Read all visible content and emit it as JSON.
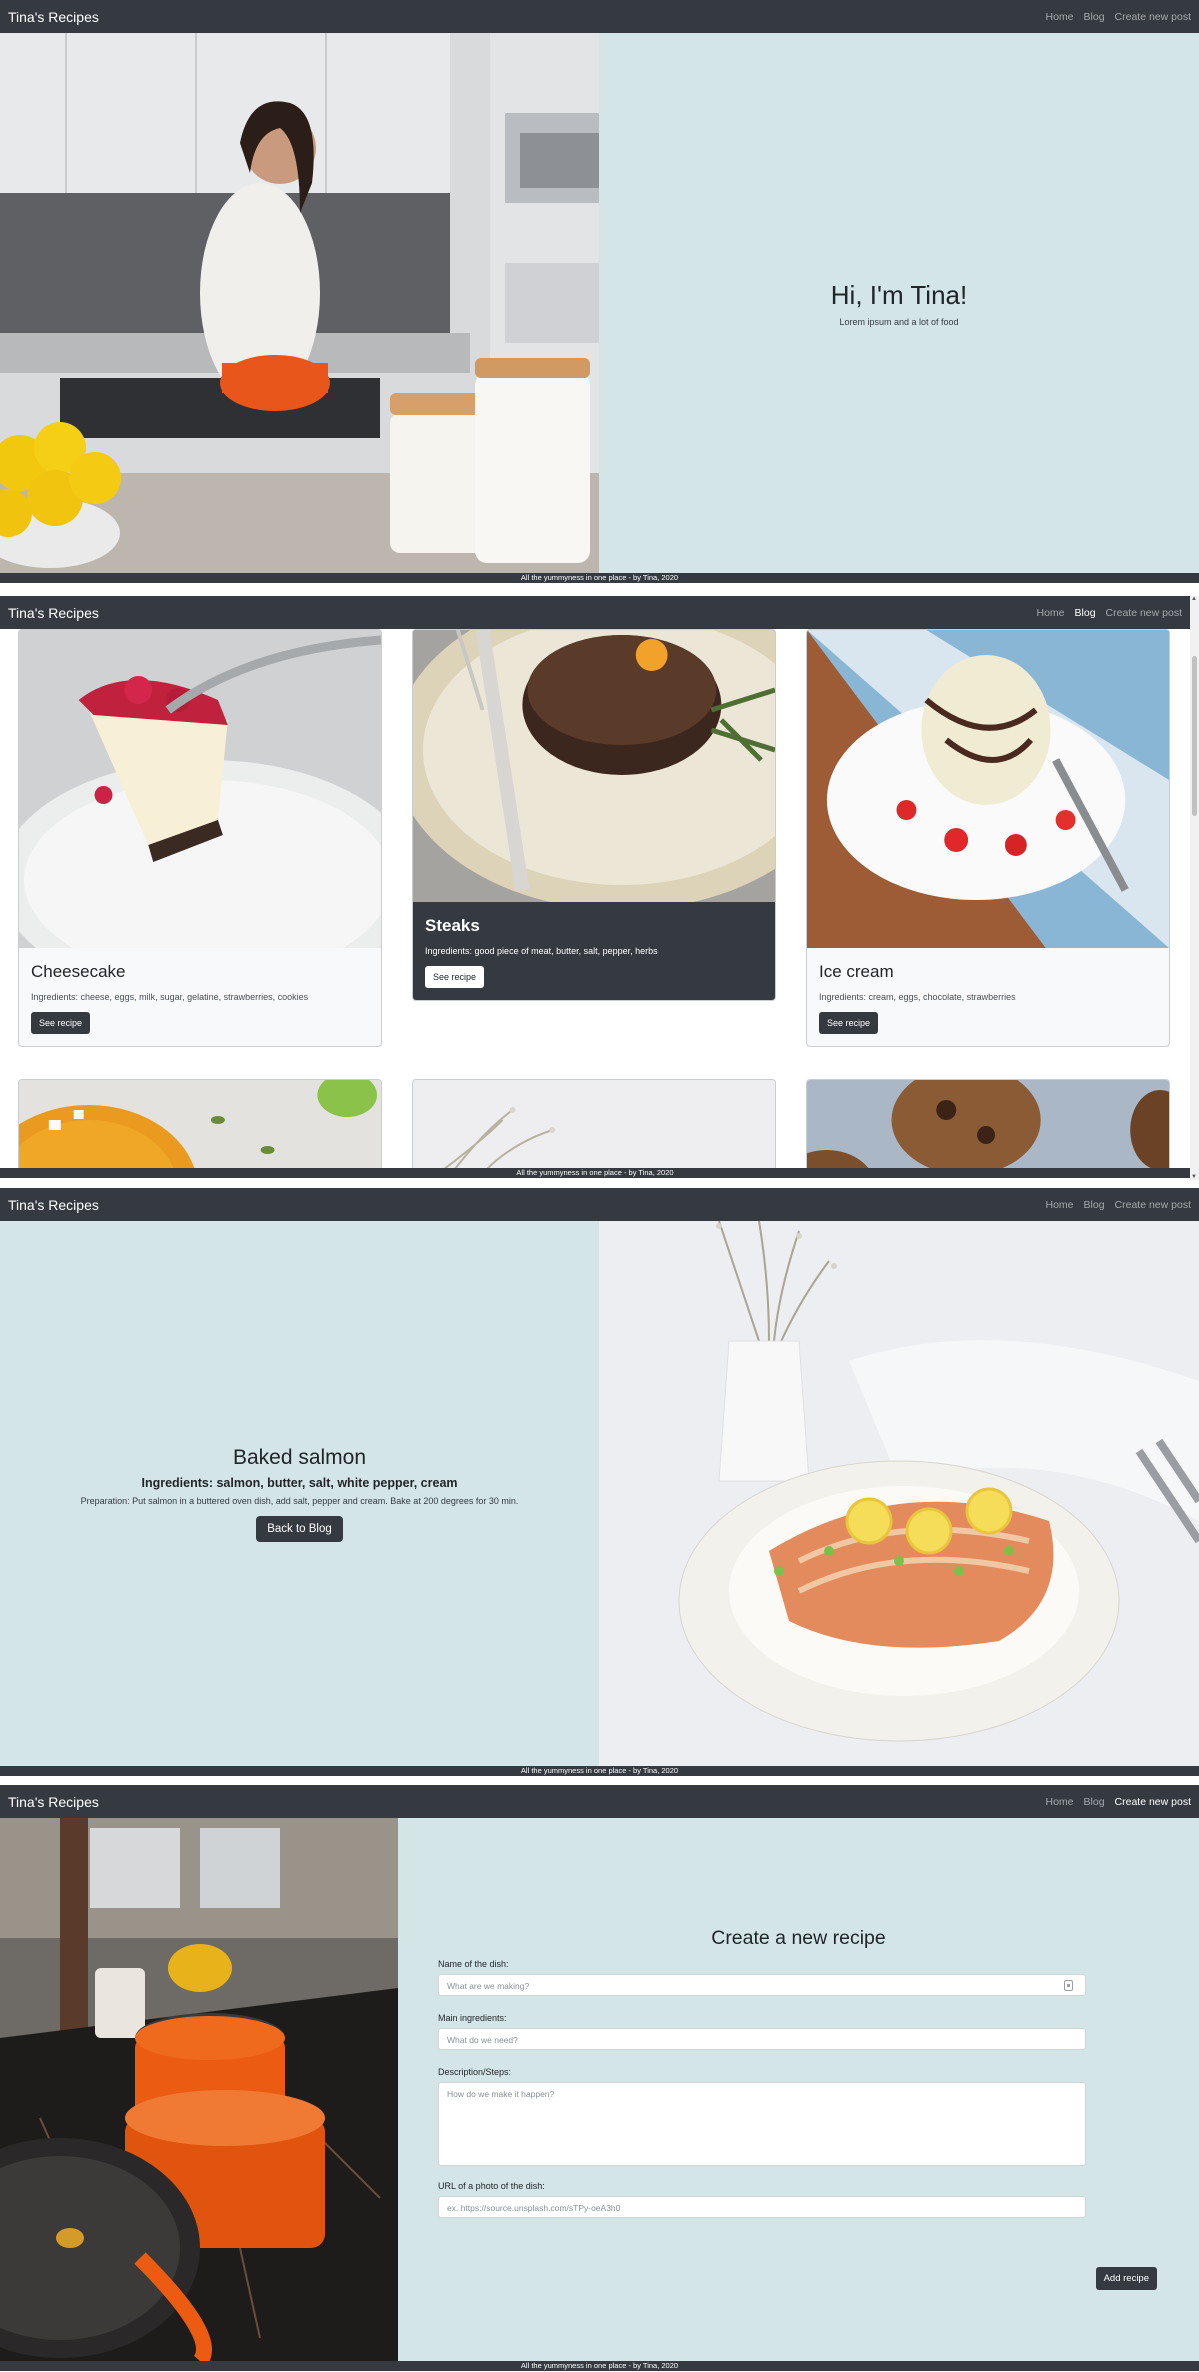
{
  "brand": "Tina's Recipes",
  "nav": {
    "home": "Home",
    "blog": "Blog",
    "create": "Create new post"
  },
  "footer": "All the yummyness in one place - by Tina, 2020",
  "home": {
    "title": "Hi, I'm Tina!",
    "subtitle": "Lorem ipsum and a lot of food"
  },
  "blog": {
    "see_recipe": "See recipe",
    "cards": [
      {
        "title": "Cheesecake",
        "ingredients": "Ingredients: cheese, eggs, milk, sugar, gelatine, strawberries, cookies"
      },
      {
        "title": "Steaks",
        "ingredients": "Ingredients: good piece of meat, butter, salt, pepper, herbs"
      },
      {
        "title": "Ice cream",
        "ingredients": "Ingredients: cream, eggs, chocolate, strawberries"
      }
    ]
  },
  "recipe": {
    "title": "Baked salmon",
    "ingredients": "Ingredients: salmon, butter, salt, white pepper, cream",
    "preparation": "Preparation: Put salmon in a buttered oven dish, add salt, pepper and cream. Bake at 200 degrees for 30 min.",
    "back": "Back to Blog"
  },
  "create": {
    "title": "Create a new recipe",
    "name_label": "Name of the dish:",
    "name_placeholder": "What are we making?",
    "ingredients_label": "Main ingredients:",
    "ingredients_placeholder": "What do we need?",
    "description_label": "Description/Steps:",
    "description_placeholder": "How do we make it happen?",
    "url_label": "URL of a photo of the dish:",
    "url_placeholder": "ex. https://source.unsplash.com/sTPy-oeA3h0",
    "submit": "Add recipe"
  },
  "colors": {
    "dark": "#343a40",
    "pale_teal": "#d4e5e7",
    "card_bg": "#f8f9fa"
  }
}
